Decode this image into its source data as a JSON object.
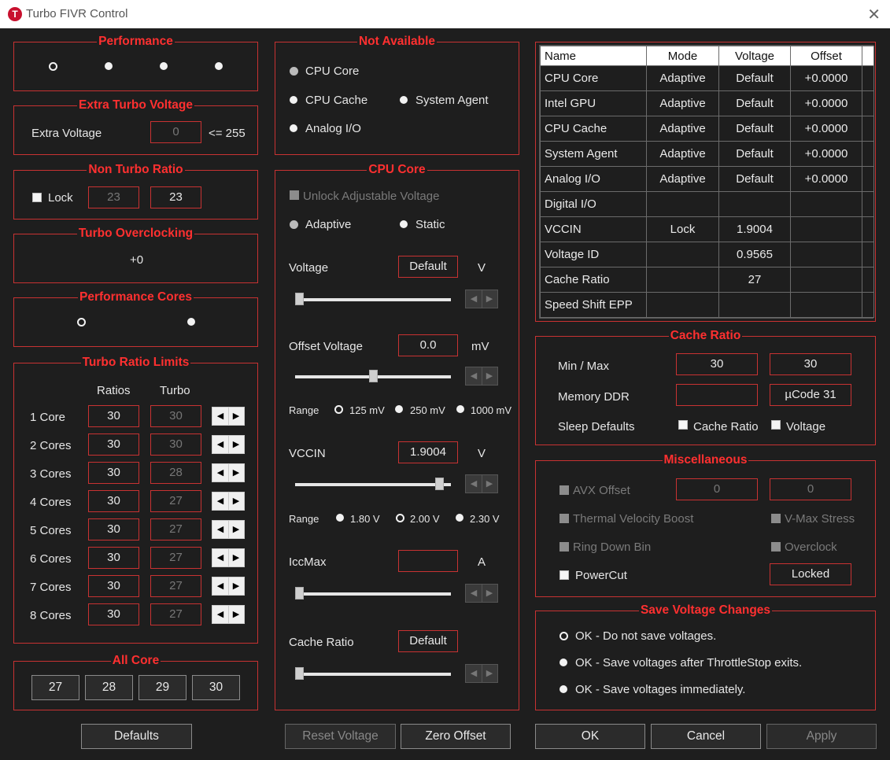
{
  "window": {
    "title": "Turbo FIVR Control",
    "app_icon_letter": "T"
  },
  "performance": {
    "title": "Performance"
  },
  "extra_turbo_voltage": {
    "title": "Extra Turbo Voltage",
    "label": "Extra Voltage",
    "value": "0",
    "limit": "<= 255"
  },
  "non_turbo_ratio": {
    "title": "Non Turbo Ratio",
    "lock_label": "Lock",
    "value1": "23",
    "value2": "23"
  },
  "turbo_overclocking": {
    "title": "Turbo Overclocking",
    "value": "+0"
  },
  "performance_cores": {
    "title": "Performance Cores"
  },
  "turbo_ratio_limits": {
    "title": "Turbo Ratio Limits",
    "col_ratios": "Ratios",
    "col_turbo": "Turbo",
    "rows": [
      {
        "label": "1 Core",
        "ratio": "30",
        "turbo": "30"
      },
      {
        "label": "2 Cores",
        "ratio": "30",
        "turbo": "30"
      },
      {
        "label": "3 Cores",
        "ratio": "30",
        "turbo": "28"
      },
      {
        "label": "4 Cores",
        "ratio": "30",
        "turbo": "27"
      },
      {
        "label": "5 Cores",
        "ratio": "30",
        "turbo": "27"
      },
      {
        "label": "6 Cores",
        "ratio": "30",
        "turbo": "27"
      },
      {
        "label": "7 Cores",
        "ratio": "30",
        "turbo": "27"
      },
      {
        "label": "8 Cores",
        "ratio": "30",
        "turbo": "27"
      }
    ]
  },
  "all_core": {
    "title": "All Core",
    "buttons": [
      "27",
      "28",
      "29",
      "30"
    ]
  },
  "not_available": {
    "title": "Not Available",
    "cpu_core": "CPU Core",
    "cpu_cache": "CPU Cache",
    "system_agent": "System Agent",
    "analog_io": "Analog I/O"
  },
  "cpu_core": {
    "title": "CPU Core",
    "unlock_label": "Unlock Adjustable Voltage",
    "adaptive_label": "Adaptive",
    "static_label": "Static",
    "voltage_label": "Voltage",
    "voltage_value": "Default",
    "voltage_unit": "V",
    "offset_label": "Offset Voltage",
    "offset_value": "0.0",
    "offset_unit": "mV",
    "range_label": "Range",
    "offset_ranges": [
      "125 mV",
      "250 mV",
      "1000 mV"
    ],
    "vccin_label": "VCCIN",
    "vccin_value": "1.9004",
    "vccin_unit": "V",
    "vccin_ranges": [
      "1.80 V",
      "2.00 V",
      "2.30 V"
    ],
    "iccmax_label": "IccMax",
    "iccmax_value": "",
    "iccmax_unit": "A",
    "cache_ratio_label": "Cache Ratio",
    "cache_ratio_value": "Default"
  },
  "voltage_table": {
    "headers": [
      "Name",
      "Mode",
      "Voltage",
      "Offset"
    ],
    "rows": [
      [
        "CPU Core",
        "Adaptive",
        "Default",
        "+0.0000"
      ],
      [
        "Intel GPU",
        "Adaptive",
        "Default",
        "+0.0000"
      ],
      [
        "CPU Cache",
        "Adaptive",
        "Default",
        "+0.0000"
      ],
      [
        "System Agent",
        "Adaptive",
        "Default",
        "+0.0000"
      ],
      [
        "Analog I/O",
        "Adaptive",
        "Default",
        "+0.0000"
      ],
      [
        "Digital I/O",
        "",
        "",
        ""
      ],
      [
        "VCCIN",
        "Lock",
        "1.9004",
        ""
      ],
      [
        "Voltage ID",
        "",
        "0.9565",
        ""
      ],
      [
        "Cache Ratio",
        "",
        "27",
        ""
      ],
      [
        "Speed Shift EPP",
        "",
        "",
        ""
      ]
    ]
  },
  "cache_ratio": {
    "title": "Cache Ratio",
    "minmax_label": "Min / Max",
    "min": "30",
    "max": "30",
    "memory_label": "Memory DDR",
    "memory_value": "",
    "ucode": "µCode 31",
    "sleep_label": "Sleep Defaults",
    "sleep_cache": "Cache Ratio",
    "sleep_voltage": "Voltage"
  },
  "misc": {
    "title": "Miscellaneous",
    "avx_label": "AVX Offset",
    "avx_val1": "0",
    "avx_val2": "0",
    "tvb_label": "Thermal Velocity Boost",
    "vmax_label": "V-Max Stress",
    "ringdown_label": "Ring Down Bin",
    "overclock_label": "Overclock",
    "powercut_label": "PowerCut",
    "locked_label": "Locked"
  },
  "save_voltage": {
    "title": "Save Voltage Changes",
    "options": [
      "OK - Do not save voltages.",
      "OK - Save voltages after ThrottleStop exits.",
      "OK - Save voltages immediately."
    ]
  },
  "buttons": {
    "defaults": "Defaults",
    "reset": "Reset Voltage",
    "zero": "Zero Offset",
    "ok": "OK",
    "cancel": "Cancel",
    "apply": "Apply"
  }
}
